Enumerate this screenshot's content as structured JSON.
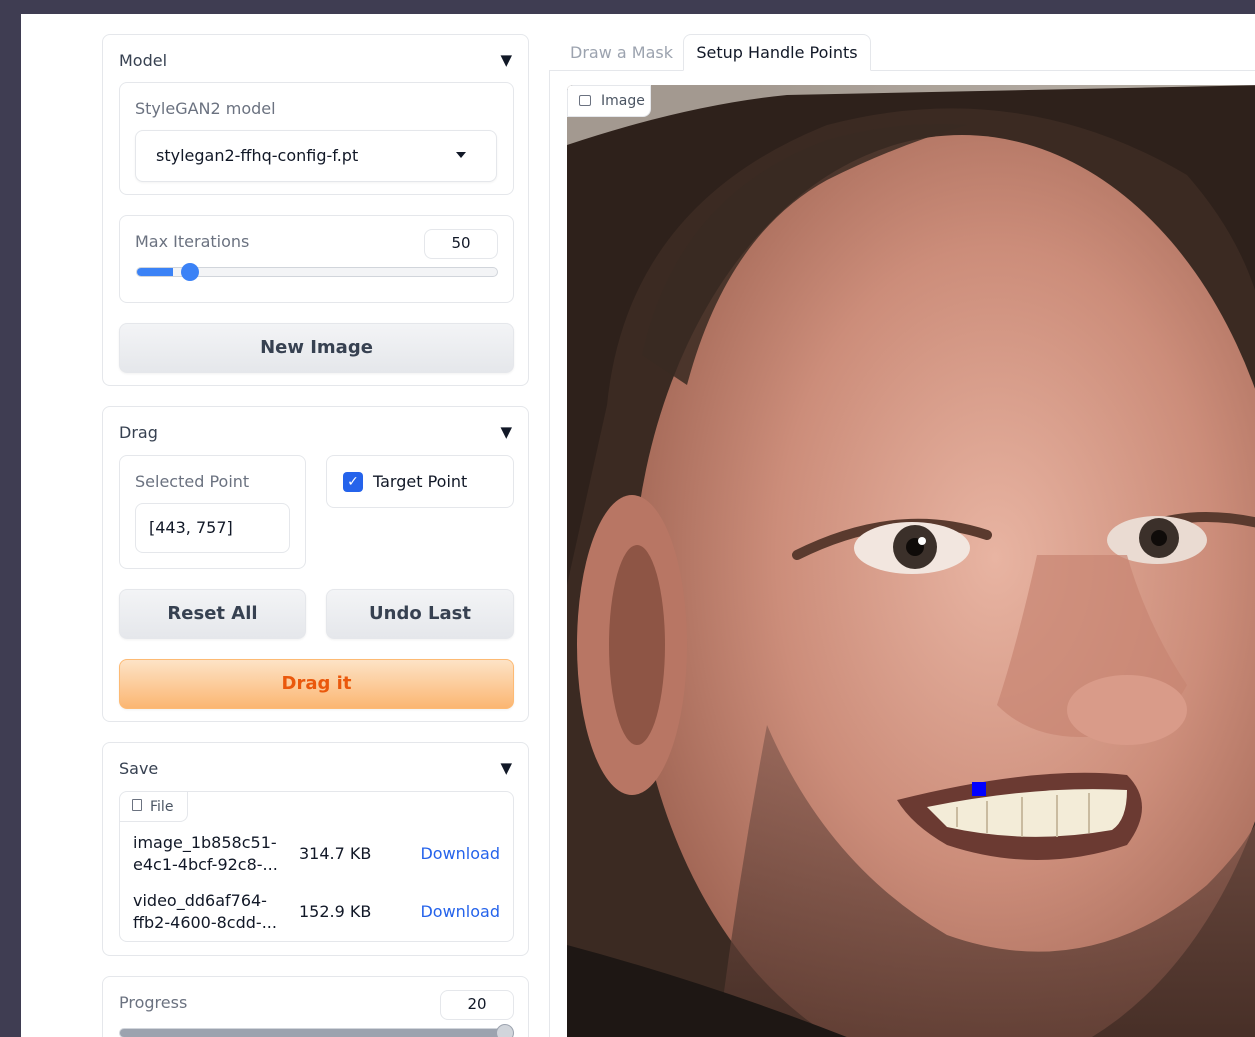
{
  "tabs": [
    {
      "label": "Draw a Mask",
      "active": false
    },
    {
      "label": "Setup Handle Points",
      "active": true
    }
  ],
  "model_panel": {
    "title": "Model",
    "model_label": "StyleGAN2 model",
    "model_value": "stylegan2-ffhq-config-f.pt",
    "max_iter_label": "Max Iterations",
    "max_iter_value": "50",
    "max_iter_fraction": 0.1,
    "new_image_button": "New Image"
  },
  "drag_panel": {
    "title": "Drag",
    "selected_point_label": "Selected Point",
    "selected_point_value": "[443, 757]",
    "target_point_label": "Target Point",
    "target_point_checked": true,
    "reset_all_button": "Reset All",
    "undo_last_button": "Undo Last",
    "drag_button": "Drag it"
  },
  "save_panel": {
    "title": "Save",
    "file_chip": "File",
    "files": [
      {
        "name_line1": "image_1b858c51-",
        "name_line2": "e4c1-4bcf-92c8-...",
        "size": "314.7 KB",
        "action": "Download"
      },
      {
        "name_line1": "video_dd6af764-",
        "name_line2": "ffb2-4600-8cdd-...",
        "size": "152.9 KB",
        "action": "Download"
      }
    ]
  },
  "progress_panel": {
    "label": "Progress",
    "value": "20",
    "fraction": 1.0
  },
  "image": {
    "label": "Image"
  },
  "colors": {
    "accent": "#3b82f6",
    "primary_button": "#fbb672",
    "link": "#2563eb",
    "handle_point": "#0000ff"
  }
}
